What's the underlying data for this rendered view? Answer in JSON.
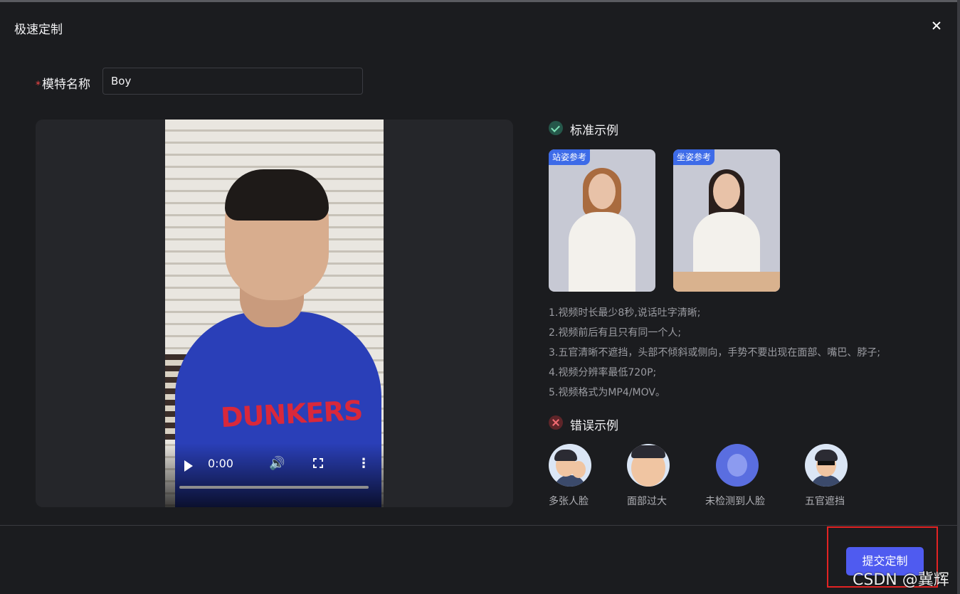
{
  "dialog": {
    "title": "极速定制",
    "close_label": "×"
  },
  "form": {
    "required_mark": "*",
    "model_name_label": "模特名称",
    "model_name_value": "Boy"
  },
  "video": {
    "shirt_text": "DUNKERS",
    "time": "0:00",
    "progress": 0,
    "icons": {
      "play": "play-icon",
      "volume": "volume-icon",
      "fullscreen": "fullscreen-icon",
      "more": "more-vertical-icon"
    }
  },
  "standard": {
    "heading": "标准示例",
    "icon": "check-circle-icon",
    "samples": [
      {
        "tag": "站姿参考"
      },
      {
        "tag": "坐姿参考"
      }
    ],
    "rules": [
      "1.视频时长最少8秒,说话吐字清晰;",
      "2.视频前后有且只有同一个人;",
      "3.五官清晰不遮挡，头部不倾斜或侧向，手势不要出现在面部、嘴巴、脖子;",
      "4.视频分辨率最低720P;",
      "5.视频格式为MP4/MOV。"
    ]
  },
  "wrong": {
    "heading": "错误示例",
    "icon": "x-circle-icon",
    "items": [
      {
        "label": "多张人脸"
      },
      {
        "label": "面部过大"
      },
      {
        "label": "未检测到人脸"
      },
      {
        "label": "五官遮挡"
      }
    ]
  },
  "footer": {
    "submit_label": "提交定制"
  },
  "watermark": "CSDN @冀辉",
  "colors": {
    "background": "#1b1c1f",
    "accent": "#4f5bf0",
    "highlight": "#e32323",
    "tag": "#3d6be8"
  }
}
